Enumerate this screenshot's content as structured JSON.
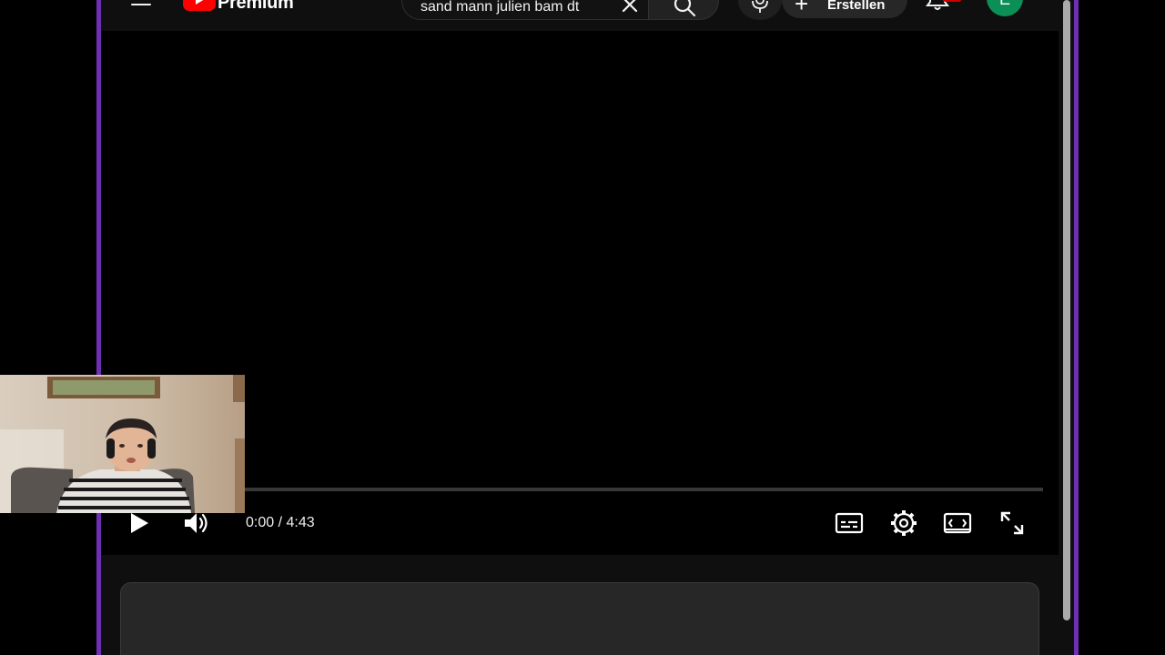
{
  "header": {
    "brand": "Premium",
    "search": {
      "value": "sand mann julien bam dt"
    },
    "create_label": "Erstellen",
    "avatar_letter": "E"
  },
  "player": {
    "progress": 0,
    "time": {
      "current": "0:00",
      "separator": "/",
      "duration": "4:43"
    }
  },
  "colors": {
    "frame": "#6f2fb5",
    "accent": "#ff0000",
    "avatar": "#0b8f57",
    "background": "#0f0f0f"
  },
  "icons": {
    "menu": "menu-icon",
    "clear": "close-icon",
    "search": "search-icon",
    "mic": "mic-icon",
    "create": "plus-icon",
    "notifications": "bell-icon",
    "play": "play-icon",
    "volume": "volume-icon",
    "subtitles": "subtitles-icon",
    "settings": "gear-icon",
    "theater": "theater-mode-icon",
    "fullscreen": "fullscreen-icon"
  }
}
